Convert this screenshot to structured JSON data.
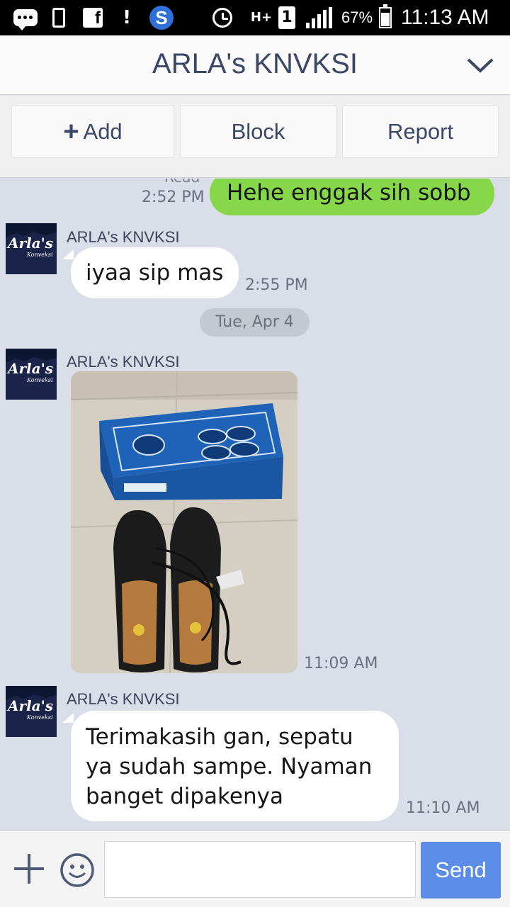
{
  "status_bar": {
    "network": "H+",
    "sim": "1",
    "battery_percent": "67%",
    "battery_level": 0.67,
    "time": "11:13 AM",
    "icons": [
      "chat-bubble-icon",
      "phone-check-icon",
      "facebook-icon",
      "alert-icon",
      "s-app-icon",
      "alarm-icon",
      "signal-icon",
      "battery-icon"
    ]
  },
  "header": {
    "title": "ARLA's KNVKSI"
  },
  "actions": {
    "add_label": "Add",
    "block_label": "Block",
    "report_label": "Report"
  },
  "messages": [
    {
      "direction": "out",
      "status": "Read",
      "time": "2:52 PM",
      "text": "Hehe enggak sih sobb"
    },
    {
      "direction": "in",
      "sender": "ARLA's KNVKSI",
      "text": "iyaa sip mas",
      "time": "2:55 PM"
    },
    {
      "type": "date",
      "text": "Tue, Apr 4"
    },
    {
      "direction": "in",
      "sender": "ARLA's KNVKSI",
      "type": "image",
      "time": "11:09 AM"
    },
    {
      "direction": "in",
      "sender": "ARLA's KNVKSI",
      "lines": [
        "Terimakasih gan,  sepatu",
        "ya sudah sampe.  Nyaman",
        "banget dipakenya"
      ],
      "time": "11:10 AM"
    }
  ],
  "avatar_logo": {
    "line1": "Arla's",
    "line2": "Konveksi"
  },
  "composer": {
    "placeholder": "",
    "send_label": "Send"
  },
  "colors": {
    "outgoing_bubble": "#86d74a",
    "incoming_bubble": "#ffffff",
    "chat_background": "#d9dee8",
    "send_button": "#5b8de8",
    "title_text": "#3b4766"
  }
}
